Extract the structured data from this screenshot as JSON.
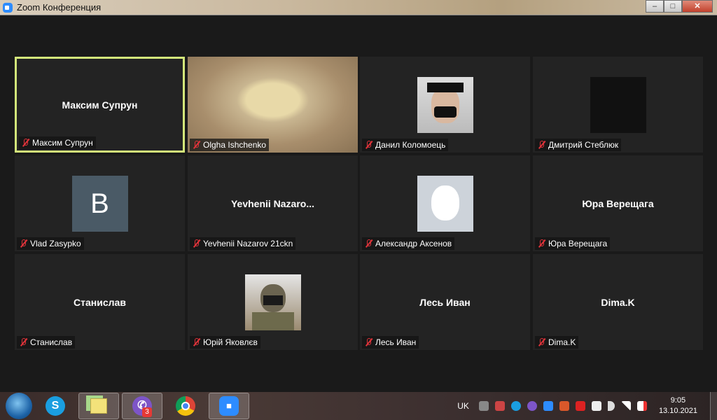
{
  "window": {
    "title": "Zoom Конференция",
    "minimize": "–",
    "maximize": "□",
    "close": "✕"
  },
  "participants": [
    {
      "name": "Максим Супрун",
      "display": "Максим Супрун",
      "type": "name",
      "active": true
    },
    {
      "name": "Olgha Ishchenko",
      "type": "video"
    },
    {
      "name": "Данил Коломоець",
      "type": "photo"
    },
    {
      "name": "Дмитрий Стеблюк",
      "type": "dark"
    },
    {
      "name": "Vlad Zasypko",
      "type": "letter",
      "letter": "B"
    },
    {
      "name": "Yevhenii Nazarov 21ckn",
      "display": "Yevhenii  Nazaro...",
      "type": "name"
    },
    {
      "name": "Александр Аксенов",
      "type": "dog"
    },
    {
      "name": "Юра Верещага",
      "display": "Юра Верещага",
      "type": "name"
    },
    {
      "name": "Станислав",
      "display": "Станислав",
      "type": "name"
    },
    {
      "name": "Юрій Яковлєв",
      "type": "photo2"
    },
    {
      "name": "Лесь Иван",
      "display": "Лесь Иван",
      "type": "name"
    },
    {
      "name": "Dima.K",
      "display": "Dima.K",
      "type": "name"
    }
  ],
  "taskbar": {
    "apps": [
      "start",
      "skype",
      "sticky-notes",
      "viber",
      "chrome",
      "zoom"
    ],
    "viber_badge": "3",
    "skype_letter": "S"
  },
  "tray": {
    "language": "UK",
    "time": "9:05",
    "date": "13.10.2021"
  },
  "colors": {
    "active_border": "#d3e67a",
    "muted": "#e0333a",
    "zoom_blue": "#2d8cff"
  }
}
